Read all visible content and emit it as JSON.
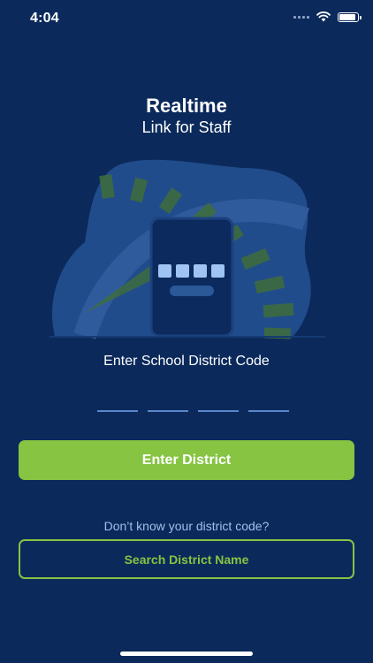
{
  "status_bar": {
    "time": "4:04",
    "icons": [
      "cellular-signal-icon",
      "wifi-icon",
      "battery-icon"
    ],
    "battery_level": 0.9
  },
  "header": {
    "title": "Realtime",
    "subtitle": "Link for Staff"
  },
  "illustration": {
    "icon": "phone-code-entry-illustration"
  },
  "form": {
    "prompt": "Enter School District Code",
    "code_length": 4,
    "code_value": ""
  },
  "actions": {
    "enter_label": "Enter District",
    "help_text": "Don’t know your district code?",
    "search_label": "Search District Name"
  },
  "colors": {
    "background": "#0b2a5b",
    "accent_green": "#86c442",
    "code_underline": "#5b86c9",
    "help_text": "#9fc0ea"
  }
}
